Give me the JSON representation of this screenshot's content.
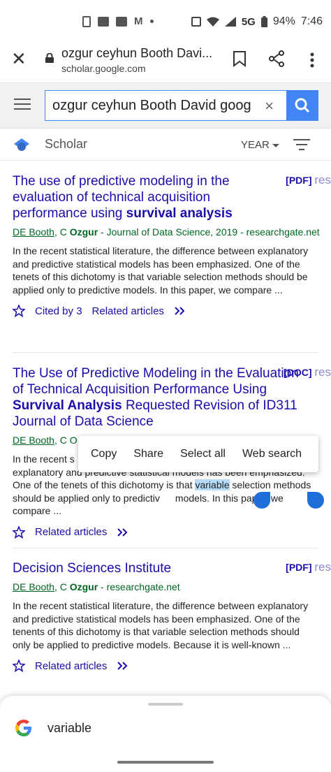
{
  "status_bar": {
    "network": "5G",
    "battery": "94%",
    "time": "7:46"
  },
  "address_bar": {
    "title": "ozgur ceyhun Booth Davi...",
    "host": "scholar.google.com"
  },
  "search": {
    "query": "ozgur ceyhun Booth David goog",
    "clear": "×"
  },
  "scholar": {
    "label": "Scholar",
    "year": "YEAR"
  },
  "results": [
    {
      "title_a": "The use of predictive modeling in the evaluation of technical acquisition performance using ",
      "title_b": "survival analysis",
      "title_c": "",
      "title_d": "",
      "tag": "[PDF]",
      "src": "res",
      "author1": "DE Booth",
      "author_sep": ", C ",
      "author2": "Ozgur",
      "venue": " - Journal of Data Science, 2019 - researchgate.net",
      "snippet": "In the recent statistical literature, the difference between explanatory and predictive statistical models has been emphasized. One of the tenets of this dichotomy is that variable selection methods should be applied only to predictive models. In this paper, we compare ...",
      "cited": "Cited by 3",
      "related": "Related articles"
    },
    {
      "title_a": "The Use of Predictive Modeling in the Evaluation of Technical Acquisition Performance Using ",
      "title_b": "Survival Analysis",
      "title_c": " Requested Revision of ID311 Journal of Data Science",
      "tag": "[DOC]",
      "src": "res",
      "author1": "DE Booth",
      "author_sep": ", C O",
      "snippet_a": "In the recent s",
      "snippet_b": "explanatory and predictive statistical models has been emphasized. One of the tenets of this dichotomy is that ",
      "snippet_hl": "variable",
      "snippet_c": " selection methods should be applied only to predictiv",
      "snippet_d": "models. In this paper, we compare ...",
      "related": "Related articles"
    },
    {
      "title_a": "Decision Sciences Institute",
      "tag": "[PDF]",
      "src": "res",
      "author1": "DE Booth",
      "author_sep": ", C ",
      "author2": "Ozgur",
      "venue": " - researchgate.net",
      "snippet": "In the recent statistical literature, the difference between explanatory and predictive statistical models has been emphasized. One of the tenents of this dichotomy is that variable selection methods should only be applied to predictive models. Because it is well-known ...",
      "related": "Related articles"
    }
  ],
  "popup": {
    "copy": "Copy",
    "share": "Share",
    "select_all": "Select all",
    "web_search": "Web search"
  },
  "sheet": {
    "word": "variable"
  },
  "colors": {
    "link": "#1a0dab",
    "author": "#006621",
    "accent": "#4285f4",
    "handle": "#1e6fd9"
  }
}
